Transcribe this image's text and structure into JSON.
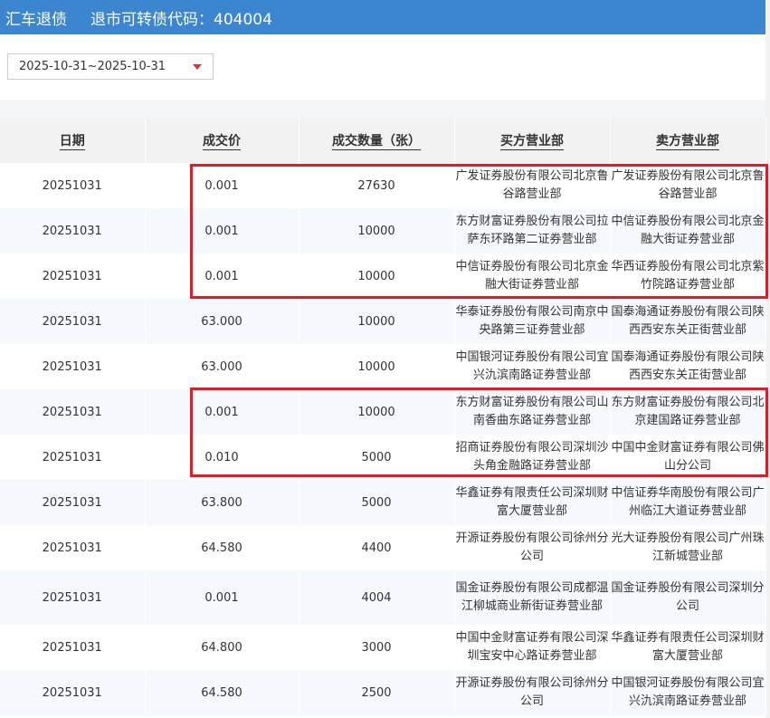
{
  "header": {
    "bond_name": "汇车退债",
    "code_label": "退市可转债代码：404004"
  },
  "date_range": {
    "value": "2025-10-31~2025-10-31"
  },
  "table": {
    "columns": [
      "日期",
      "成交价",
      "成交数量（张）",
      "买方营业部",
      "卖方营业部"
    ],
    "rows": [
      {
        "date": "20251031",
        "price": "0.001",
        "qty": "27630",
        "buyer": "广发证券股份有限公司北京鲁谷路营业部",
        "seller": "广发证券股份有限公司北京鲁谷路营业部"
      },
      {
        "date": "20251031",
        "price": "0.001",
        "qty": "10000",
        "buyer": "东方财富证券股份有限公司拉萨东环路第二证券营业部",
        "seller": "中信证券股份有限公司北京金融大街证券营业部"
      },
      {
        "date": "20251031",
        "price": "0.001",
        "qty": "10000",
        "buyer": "中信证券股份有限公司北京金融大街证券营业部",
        "seller": "华西证券股份有限公司北京紫竹院路证券营业部"
      },
      {
        "date": "20251031",
        "price": "63.000",
        "qty": "10000",
        "buyer": "华泰证券股份有限公司南京中央路第三证券营业部",
        "seller": "国泰海通证券股份有限公司陕西西安东关正街营业部"
      },
      {
        "date": "20251031",
        "price": "63.000",
        "qty": "10000",
        "buyer": "中国银河证券股份有限公司宜兴氿滨南路证券营业部",
        "seller": "国泰海通证券股份有限公司陕西西安东关正街营业部"
      },
      {
        "date": "20251031",
        "price": "0.001",
        "qty": "10000",
        "buyer": "东方财富证券股份有限公司山南香曲东路证券营业部",
        "seller": "东方财富证券股份有限公司北京建国路证券营业部"
      },
      {
        "date": "20251031",
        "price": "0.010",
        "qty": "5000",
        "buyer": "招商证券股份有限公司深圳沙头角金融路证券营业部",
        "seller": "中国中金财富证券有限公司佛山分公司"
      },
      {
        "date": "20251031",
        "price": "63.800",
        "qty": "5000",
        "buyer": "华鑫证券有限责任公司深圳财富大厦营业部",
        "seller": "中信证券华南股份有限公司广州临江大道证券营业部"
      },
      {
        "date": "20251031",
        "price": "64.580",
        "qty": "4400",
        "buyer": "开源证券股份有限公司徐州分公司",
        "seller": "光大证券股份有限公司广州珠江新城营业部"
      },
      {
        "date": "20251031",
        "price": "0.001",
        "qty": "4004",
        "buyer": "国金证券股份有限公司成都温江柳城商业新街证券营业部",
        "seller": "国金证券股份有限公司深圳分公司"
      },
      {
        "date": "20251031",
        "price": "64.800",
        "qty": "3000",
        "buyer": "中国中金财富证券有限公司深圳宝安中心路证券营业部",
        "seller": "华鑫证券有限责任公司深圳财富大厦营业部"
      },
      {
        "date": "20251031",
        "price": "64.580",
        "qty": "2500",
        "buyer": "开源证券股份有限公司徐州分公司",
        "seller": "中国银河证券股份有限公司宜兴氿滨南路证券营业部"
      }
    ]
  }
}
